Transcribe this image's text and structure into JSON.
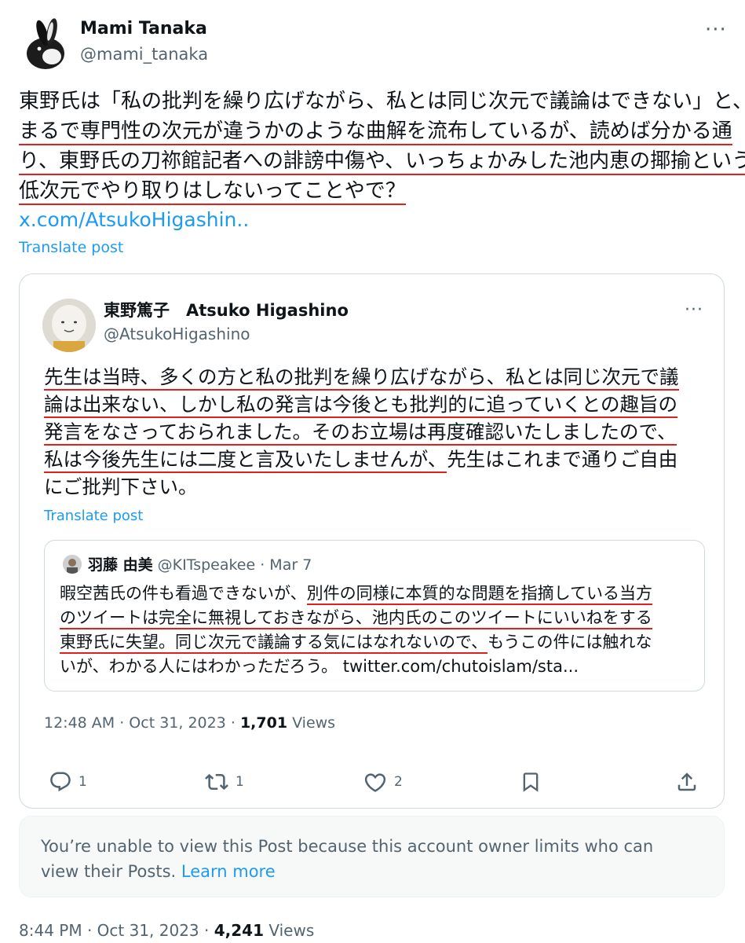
{
  "post": {
    "author": {
      "name": "Mami Tanaka",
      "handle": "@mami_tanaka"
    },
    "lines": [
      "東野氏は「私の批判を繰り広げながら、私とは同じ次元で議論はできない」と、",
      "まるで専門性の次元が違うかのような曲解を流布しているが、読めば分かる通",
      "り、東野氏の刀祢館記者への誹謗中傷や、いっちょかみした池内恵の揶揄という",
      "低次元でやり取りはしないってことやで？"
    ],
    "link": "x.com/AtsukoHigashin..",
    "translate": "Translate post",
    "time": "8:44 PM · Oct 31, 2023 · ",
    "views_count": "4,241",
    "views_label": " Views"
  },
  "quoted": {
    "author": {
      "name": "東野篤子　Atsuko Higashino",
      "handle": "@AtsukoHigashino"
    },
    "lines": [
      "先生は当時、多くの方と私の批判を繰り広げながら、私とは同じ次元で議",
      "論は出来ない、しかし私の発言は今後とも批判的に追っていくとの趣旨の",
      "発言をなさっておられました。そのお立場は再度確認いたしましたので、",
      {
        "u": "私は今後先生には二度と言及いたしませんが、",
        "rest": "先生はこれまで通りご自由"
      },
      "にご批判下さい。"
    ],
    "translate": "Translate post",
    "time": "12:48 AM · Oct 31, 2023 · ",
    "views_count": "1,701",
    "views_label": " Views",
    "actions": {
      "reply": "1",
      "retweet": "1",
      "like": "2"
    }
  },
  "inner": {
    "name": "羽藤 由美",
    "meta": " @KITspeakee · Mar 7",
    "line1_pre": "暇空茜氏の件も看過できないが、",
    "line1_u": "別件の同様に本質的な問題を指摘している当方",
    "line2": "のツイートは完全に無視しておきながら、池内氏のこのツイートにいいねをする",
    "line3_u": "東野氏に失望。同じ次元で議論する気にはなれないので、",
    "line3_rest": "もうこの件には触れな",
    "line4": "いが、わかる人にはわかっただろう。 twitter.com/chutoislam/sta..."
  },
  "notice": {
    "line1": "You’re unable to view this Post because this account owner limits who can",
    "line2_pre": "view their Posts. ",
    "learn_more": "Learn more"
  },
  "colors": {
    "accent": "#1d9bf0",
    "underline": "#e0201c",
    "muted": "#536471"
  },
  "icons": [
    "reply-icon",
    "retweet-icon",
    "like-icon",
    "bookmark-icon",
    "share-icon",
    "more-icon"
  ]
}
